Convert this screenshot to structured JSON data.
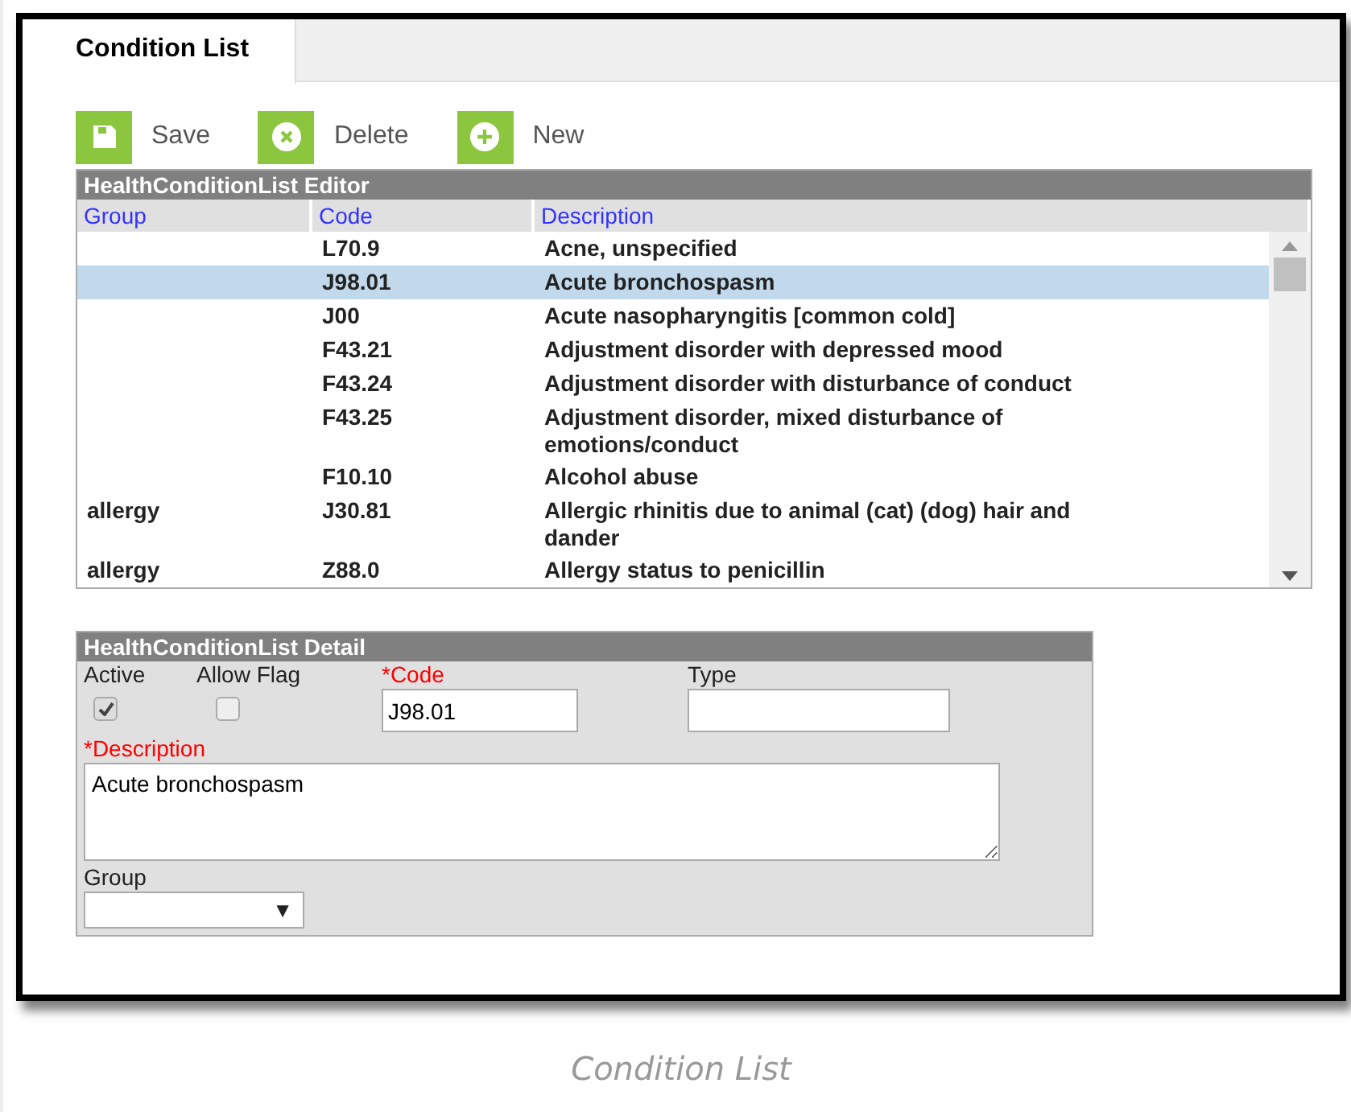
{
  "tabs": [
    {
      "label": "Condition List",
      "selected": true
    }
  ],
  "toolbar": [
    {
      "kind": "save",
      "label": "Save"
    },
    {
      "kind": "delete",
      "label": "Delete"
    },
    {
      "kind": "new",
      "label": "New"
    }
  ],
  "editor": {
    "title": "HealthConditionList Editor",
    "columns": [
      "Group",
      "Code",
      "Description"
    ],
    "rows": [
      {
        "group": "",
        "code": "L70.9",
        "description": "Acne, unspecified",
        "selected": false
      },
      {
        "group": "",
        "code": "J98.01",
        "description": "Acute bronchospasm",
        "selected": true
      },
      {
        "group": "",
        "code": "J00",
        "description": "Acute nasopharyngitis [common cold]",
        "selected": false
      },
      {
        "group": "",
        "code": "F43.21",
        "description": "Adjustment disorder with depressed mood",
        "selected": false
      },
      {
        "group": "",
        "code": "F43.24",
        "description": "Adjustment disorder with disturbance of conduct",
        "selected": false
      },
      {
        "group": "",
        "code": "F43.25",
        "description": "Adjustment disorder, mixed disturbance of emotions/conduct",
        "selected": false
      },
      {
        "group": "",
        "code": "F10.10",
        "description": "Alcohol abuse",
        "selected": false
      },
      {
        "group": "allergy",
        "code": "J30.81",
        "description": "Allergic rhinitis due to animal (cat) (dog) hair and dander",
        "selected": false
      },
      {
        "group": "allergy",
        "code": "Z88.0",
        "description": "Allergy status to penicillin",
        "selected": false
      }
    ]
  },
  "detail": {
    "title": "HealthConditionList Detail",
    "active": {
      "label": "Active",
      "checked": true
    },
    "allow_flag": {
      "label": "Allow Flag",
      "checked": false
    },
    "code": {
      "label": "*Code",
      "value": "J98.01"
    },
    "type": {
      "label": "Type"
    },
    "description": {
      "label": "*Description",
      "value": "Acute bronchospasm"
    },
    "group": {
      "label": "Group",
      "caret": "▼"
    }
  },
  "caption": "Condition List"
}
